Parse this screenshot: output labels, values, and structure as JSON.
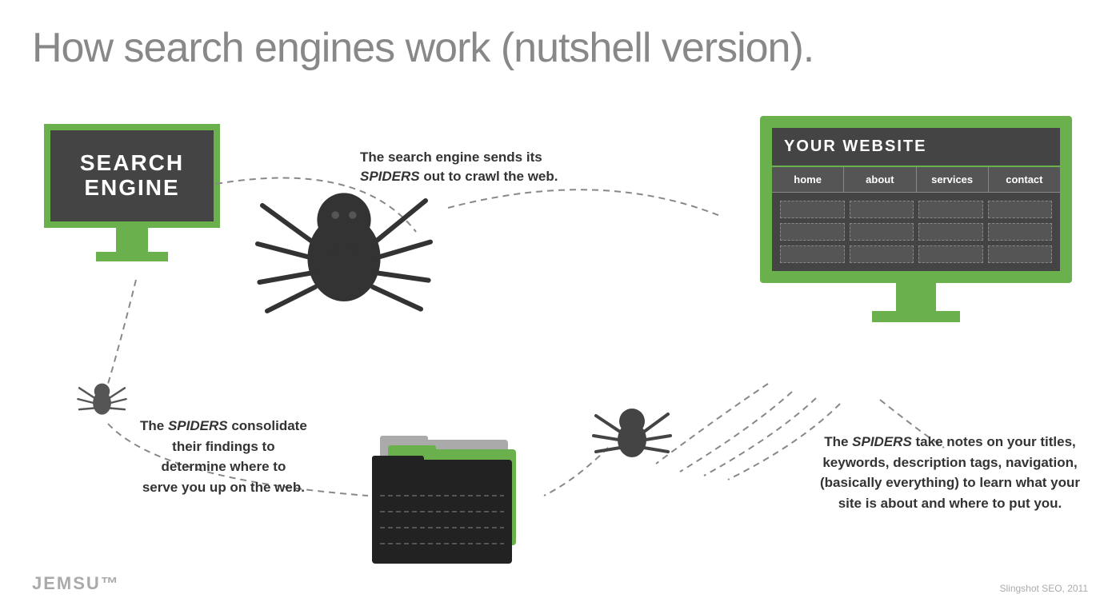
{
  "title": "How search engines work (nutshell version).",
  "search_engine": {
    "label_line1": "SEARCH",
    "label_line2": "ENGINE"
  },
  "website": {
    "title": "YOUR WEBSITE",
    "nav": [
      "home",
      "about",
      "services",
      "contact"
    ]
  },
  "callouts": {
    "top": "The search engine sends its SPIDERS out to crawl the web.",
    "bottom_left": "The SPIDERS consolidate their findings to determine where to serve you up on the web.",
    "bottom_right": "The SPIDERS take notes on your titles, keywords, description tags, navigation, (basically everything) to learn what your site is about and where to put you."
  },
  "brand": "JEMSU™",
  "credit": "Slingshot SEO, 2011",
  "colors": {
    "green": "#6ab04c",
    "dark": "#444444",
    "text": "#333333",
    "light_gray": "#aaaaaa"
  }
}
